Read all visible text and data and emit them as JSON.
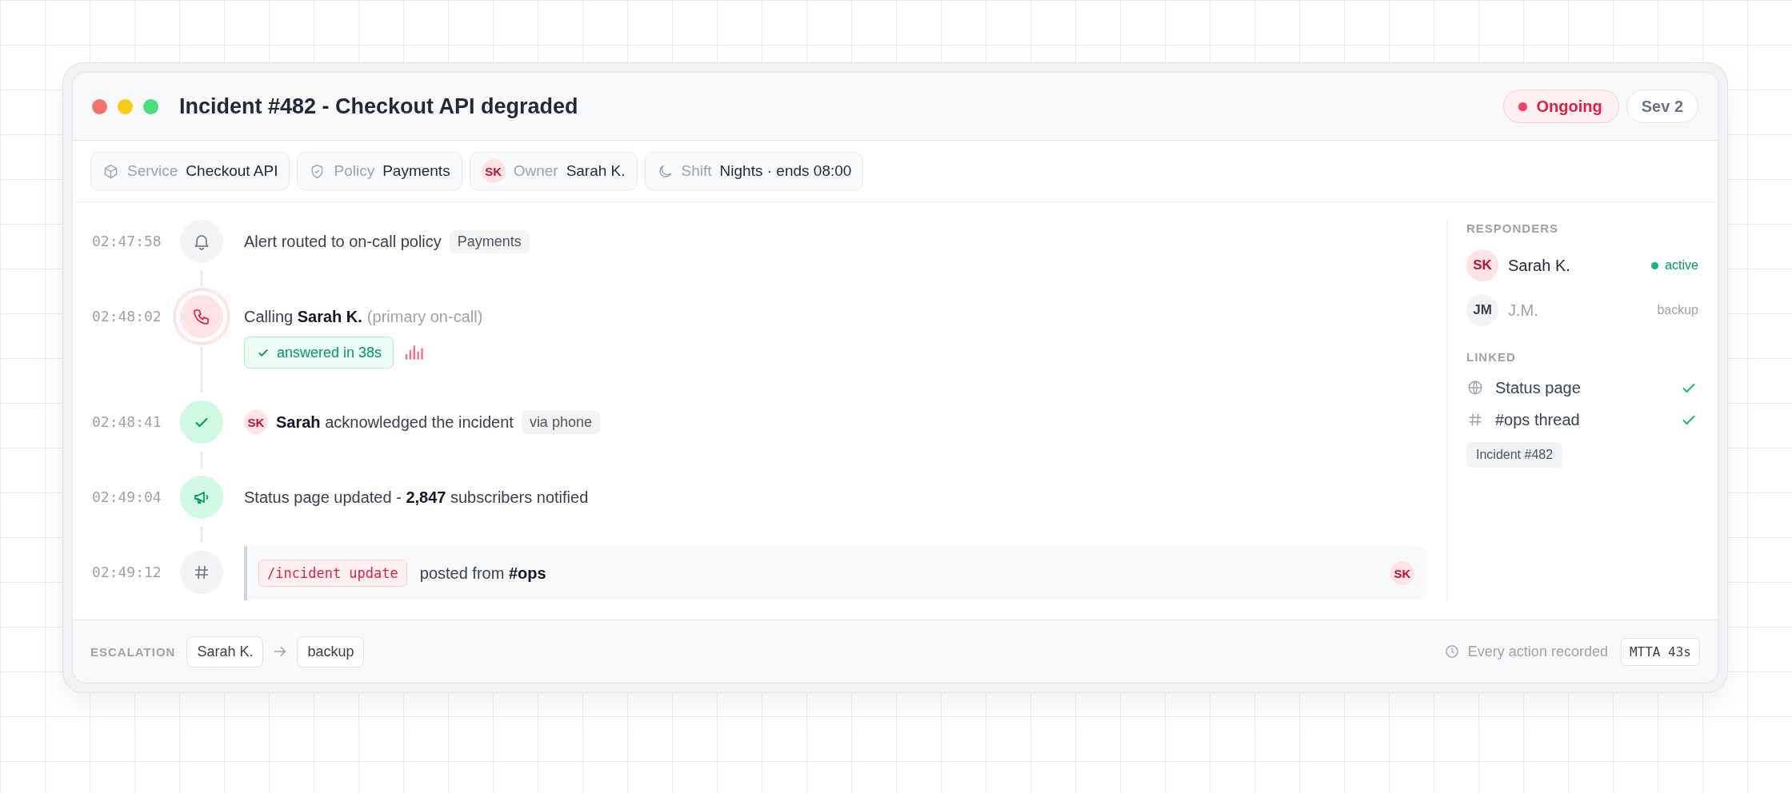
{
  "window": {
    "title": "Incident #482 - Checkout API degraded"
  },
  "status": {
    "label": "Ongoing"
  },
  "severity": "Sev 2",
  "meta": [
    {
      "kind": "service",
      "label": "Service",
      "value": "Checkout API"
    },
    {
      "kind": "policy",
      "label": "Policy",
      "value": "Payments"
    },
    {
      "kind": "owner",
      "avatar": "SK",
      "label": "Owner",
      "value": "Sarah K."
    },
    {
      "kind": "shift",
      "label": "Shift",
      "value": "Nights · ends 08:00"
    }
  ],
  "timeline": [
    {
      "time": "02:47:58",
      "kind": "alert",
      "text": "Alert routed to on-call policy",
      "tag": "Payments"
    },
    {
      "time": "02:48:02",
      "kind": "call",
      "text": "Calling **Sarah K.**",
      "note": "(primary on-call)",
      "badge": "answered in 38s"
    },
    {
      "time": "02:48:41",
      "kind": "ack",
      "avatar": "SK",
      "text": "**Sarah** acknowledged the incident",
      "tag": "via phone"
    },
    {
      "time": "02:49:04",
      "kind": "status",
      "text": "Status page updated - **2,847** subscribers notified"
    },
    {
      "time": "02:49:12",
      "kind": "command",
      "command": "/incident update",
      "text": "posted from **#ops**",
      "avatar": "SK"
    }
  ],
  "responders": {
    "title": "RESPONDERS",
    "items": [
      {
        "kind": "active",
        "initials": "SK",
        "name": "Sarah K.",
        "status": "active"
      },
      {
        "kind": "backup",
        "initials": "JM",
        "name": "J.M.",
        "status": "backup"
      }
    ]
  },
  "linked": {
    "title": "LINKED",
    "items": [
      {
        "kind": "globe",
        "label": "Status page",
        "done": true
      },
      {
        "kind": "hash",
        "label": "#ops thread",
        "done": true
      }
    ],
    "tag": "Incident #482"
  },
  "footer": {
    "label": "ESCALATION",
    "steps": [
      "Sarah K.",
      "backup"
    ],
    "recorded": "Every action recorded",
    "mtta": "MTTA 43s"
  }
}
